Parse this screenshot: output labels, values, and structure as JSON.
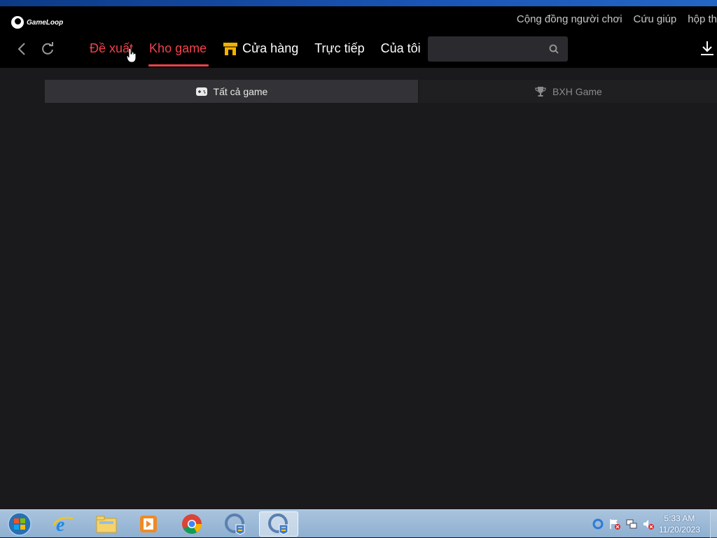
{
  "app": {
    "logo_text": "GameLoop"
  },
  "toplinks": [
    "Cộng đồng người chơi",
    "Cứu giúp",
    "hộp th"
  ],
  "tabs": [
    {
      "label": "Đề xuất"
    },
    {
      "label": "Kho game"
    },
    {
      "label": "Cửa hàng"
    },
    {
      "label": "Trực tiếp"
    },
    {
      "label": "Của tôi"
    }
  ],
  "search": {
    "placeholder": ""
  },
  "subtabs": [
    {
      "label": "Tất cả game",
      "icon": "gamepad-icon"
    },
    {
      "label": "BXH Game",
      "icon": "trophy-icon"
    }
  ],
  "taskbar": {
    "apps": [
      "start-orb",
      "internet-explorer",
      "file-explorer",
      "media-player",
      "chrome",
      "gameloop-installer",
      "gameloop"
    ],
    "time": "5:33 AM",
    "date": "11/20/2023"
  },
  "colors": {
    "accent": "#f2414c",
    "header": "#000000",
    "body": "#1a1a1c"
  }
}
